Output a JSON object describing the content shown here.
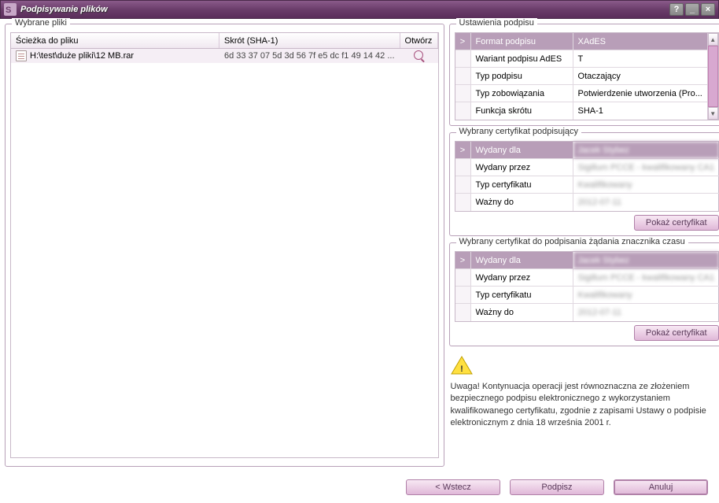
{
  "window": {
    "title": "Podpisywanie plików"
  },
  "left": {
    "legend": "Wybrane pliki",
    "headers": {
      "path": "Ścieżka do pliku",
      "hash": "Skrót (SHA-1)",
      "open": "Otwórz"
    },
    "rows": [
      {
        "path": "H:\\test\\duże pliki\\12 MB.rar",
        "hash": "6d 33 37 07 5d 3d 56 7f e5 dc f1 49 14 42 ..."
      }
    ]
  },
  "settings": {
    "legend": "Ustawienia podpisu",
    "headerKey": "Format podpisu",
    "headerVal": "XAdES",
    "rows": [
      {
        "key": "Wariant podpisu AdES",
        "val": "T"
      },
      {
        "key": "Typ podpisu",
        "val": "Otaczający"
      },
      {
        "key": "Typ zobowiązania",
        "val": "Potwierdzenie utworzenia   (Pro..."
      },
      {
        "key": "Funkcja skrótu",
        "val": "SHA-1"
      }
    ]
  },
  "cert1": {
    "legend": "Wybrany certyfikat podpisujący",
    "headerKey": "Wydany dla",
    "headerVal": "Jacek Stybez",
    "rows": [
      {
        "key": "Wydany przez",
        "val": "Sigillum PCCE - kwalifikowany CA1"
      },
      {
        "key": "Typ certyfikatu",
        "val": "Kwalifikowany"
      },
      {
        "key": "Ważny do",
        "val": "2012-07-11"
      }
    ],
    "button": "Pokaż certyfikat"
  },
  "cert2": {
    "legend": "Wybrany certyfikat do podpisania żądania znacznika czasu",
    "headerKey": "Wydany dla",
    "headerVal": "Jacek Stybez",
    "rows": [
      {
        "key": "Wydany przez",
        "val": "Sigillum PCCE - kwalifikowany CA1"
      },
      {
        "key": "Typ certyfikatu",
        "val": "Kwalifikowany"
      },
      {
        "key": "Ważny do",
        "val": "2012-07-11"
      }
    ],
    "button": "Pokaż certyfikat"
  },
  "warning": "Uwaga! Kontynuacja operacji jest równoznaczna ze złożeniem bezpiecznego podpisu elektronicznego z wykorzystaniem kwalifikowanego certyfikatu, zgodnie z zapisami Ustawy o podpisie elektronicznym z  dnia 18 września 2001 r.",
  "footer": {
    "back": "< Wstecz",
    "sign": "Podpisz",
    "cancel": "Anuluj"
  }
}
